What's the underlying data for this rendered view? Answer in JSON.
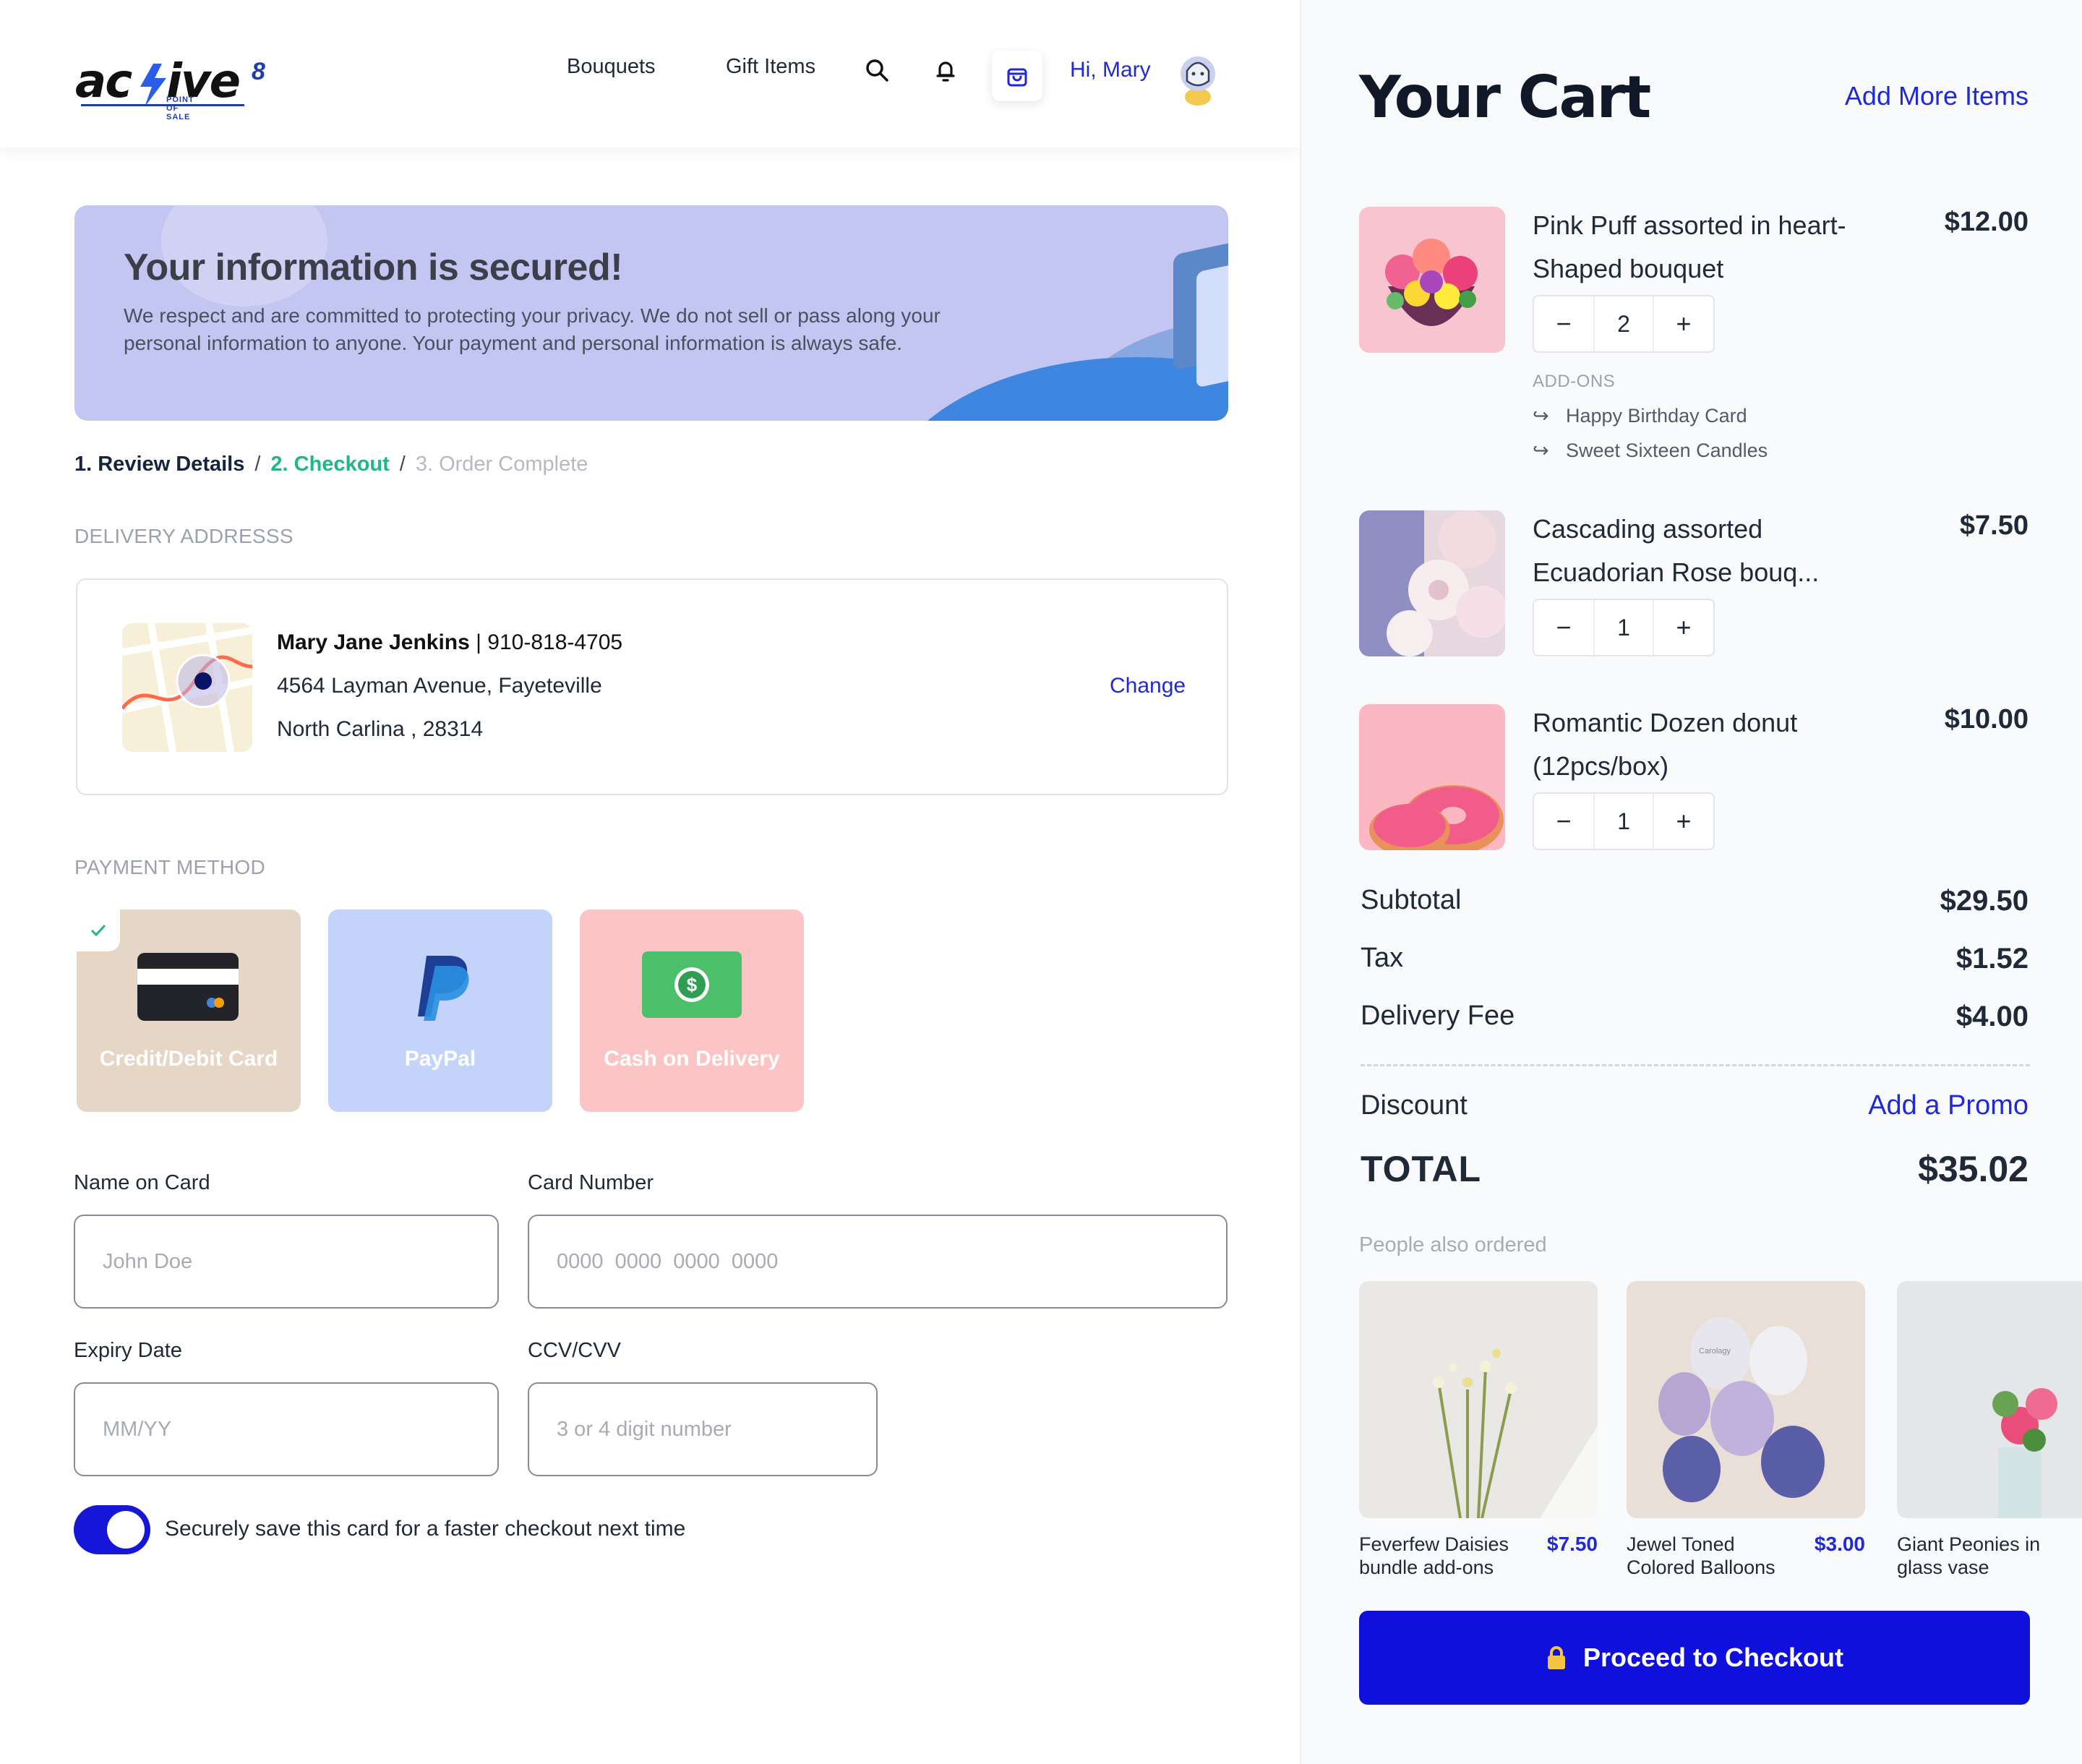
{
  "header": {
    "logo_text": "acTive",
    "logo_sup": "8",
    "logo_tagline": "POINT OF SALE",
    "nav": [
      "Bouquets",
      "Gift Items"
    ],
    "greeting": "Hi, Mary"
  },
  "banner": {
    "title": "Your information is secured!",
    "body": "We respect and are committed to protecting your privacy. We do not sell or pass along your personal information to anyone. Your payment and personal information is always safe."
  },
  "steps": {
    "step1": "1. Review Details",
    "step2": "2. Checkout",
    "step3": "3. Order Complete",
    "separator": "/"
  },
  "delivery": {
    "section_label": "DELIVERY ADDRESSS",
    "name": "Mary Jane Jenkins",
    "phone": " | 910-818-4705",
    "line1": "4564 Layman Avenue, Fayeteville",
    "line2": "North Carlina , 28314",
    "change_label": "Change"
  },
  "payment": {
    "section_label": "PAYMENT METHOD",
    "methods": [
      {
        "label": "Credit/Debit Card",
        "selected": true
      },
      {
        "label": "PayPal",
        "selected": false
      },
      {
        "label": "Cash on Delivery",
        "selected": false
      }
    ],
    "check_icon": "check-icon"
  },
  "form": {
    "name_label": "Name on Card",
    "name_placeholder": "John Doe",
    "number_label": "Card Number",
    "number_placeholder": "0000  0000  0000  0000",
    "expiry_label": "Expiry Date",
    "expiry_placeholder": "MM/YY",
    "cvv_label": "CCV/CVV",
    "cvv_placeholder": "3 or 4 digit number",
    "save_toggle_on": true,
    "save_label": "Securely save this card for a faster checkout next time"
  },
  "cart": {
    "title": "Your Cart",
    "add_more": "Add More Items",
    "items": [
      {
        "name": "Pink Puff assorted in heart-Shaped bouquet",
        "price": "$12.00",
        "qty": "2"
      },
      {
        "name": "Cascading assorted Ecuadorian Rose bouq...",
        "price": "$7.50",
        "qty": "1"
      },
      {
        "name": "Romantic Dozen donut (12pcs/box)",
        "price": "$10.00",
        "qty": "1"
      }
    ],
    "addons_label": "ADD-ONS",
    "addons": [
      "Happy Birthday Card",
      "Sweet Sixteen Candles"
    ],
    "minus": "−",
    "plus": "+",
    "addon_arrow": "↪"
  },
  "summary": {
    "subtotal_label": "Subtotal",
    "subtotal": "$29.50",
    "tax_label": "Tax",
    "tax": "$1.52",
    "delivery_label": "Delivery Fee",
    "delivery": "$4.00",
    "discount_label": "Discount",
    "promo_label": "Add a Promo",
    "total_label": "TOTAL",
    "total": "$35.02"
  },
  "recommendations": {
    "label": "People also ordered",
    "items": [
      {
        "name": "Feverfew Daisies bundle add-ons",
        "price": "$7.50"
      },
      {
        "name": "Jewel Toned Colored Balloons",
        "price": "$3.00"
      },
      {
        "name": "Giant Peonies in glass vase",
        "price": ""
      }
    ],
    "balloon_print": "Carolagy"
  },
  "checkout": {
    "label": "Proceed to Checkout"
  },
  "colors": {
    "accent": "#1010dc",
    "link": "#1f2ad6",
    "success": "#21b58a",
    "banner": "#c3c6f1"
  }
}
